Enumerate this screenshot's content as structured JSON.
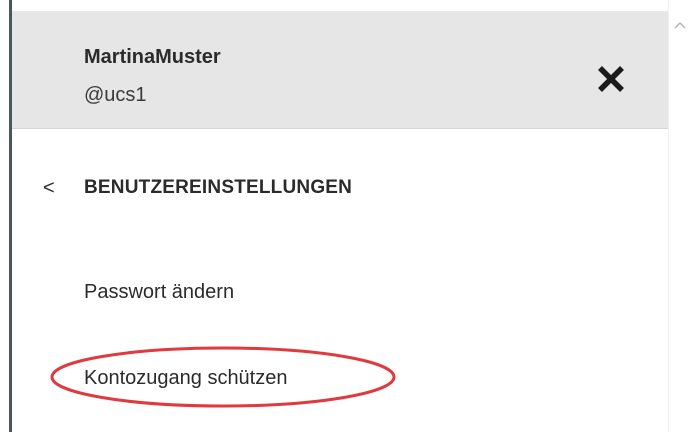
{
  "header": {
    "user_name": "MartinaMuster",
    "user_handle": "@ucs1",
    "close_icon": "close-icon"
  },
  "section": {
    "back_icon": "chevron-left-icon",
    "back_glyph": "<",
    "title": "BENUTZEREINSTELLUNGEN"
  },
  "menu": {
    "items": [
      {
        "label": "Passwort ändern"
      },
      {
        "label": "Kontozugang schützen",
        "highlighted": true
      }
    ]
  },
  "annotation": {
    "shape": "ellipse",
    "color": "#e0393e",
    "target": "Kontozugang schützen"
  },
  "colors": {
    "header_bg": "#e6e6e6",
    "text": "#2b2b2b",
    "left_border": "#4a5662"
  }
}
